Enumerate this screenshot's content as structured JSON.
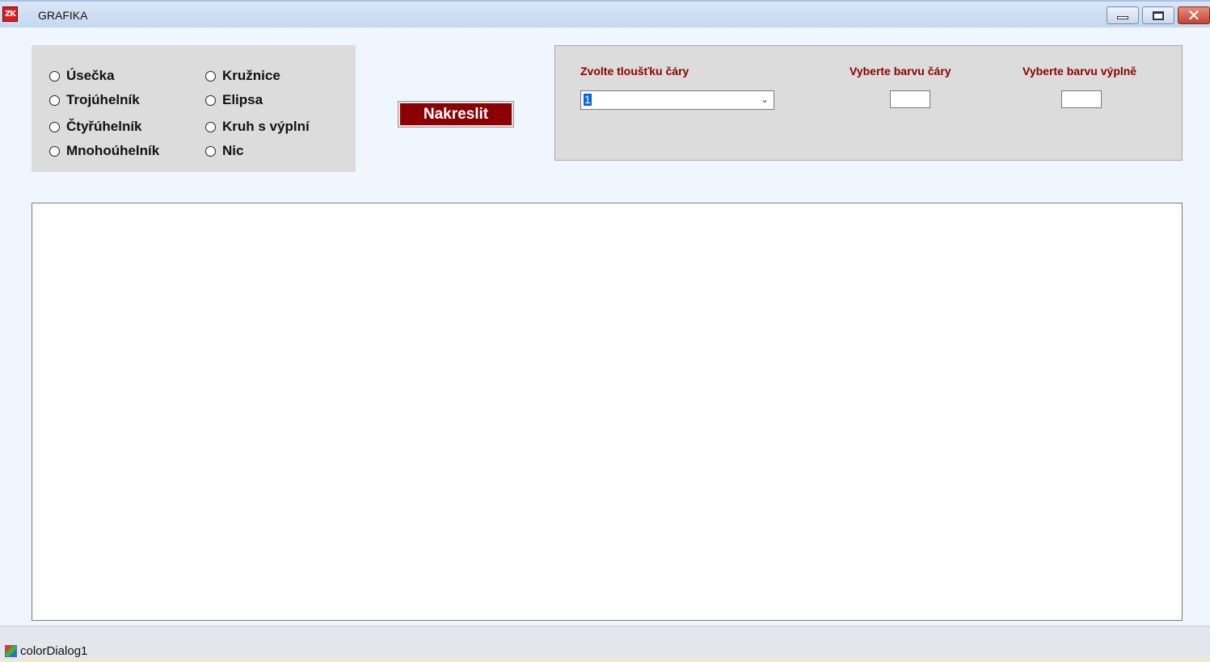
{
  "window": {
    "title": "GRAFIKA",
    "app_icon_text": "ZK",
    "controls": {
      "minimize": "minimize",
      "maximize": "maximize",
      "close": "✕"
    }
  },
  "shapes": {
    "options": [
      {
        "label": "Úsečka"
      },
      {
        "label": "Trojúhelník"
      },
      {
        "label": "Čtyřúhelník"
      },
      {
        "label": "Mnohoúhelník"
      },
      {
        "label": "Kružnice"
      },
      {
        "label": "Elipsa"
      },
      {
        "label": "Kruh s výplní"
      },
      {
        "label": "Nic"
      }
    ]
  },
  "draw_button": {
    "label": "Nakreslit"
  },
  "settings": {
    "line_width_label": "Zvolte tloušťku čáry",
    "line_width_value": "1",
    "line_color_label": "Vyberte barvu čáry",
    "fill_color_label": "Vyberte barvu výplně",
    "line_color": "#ffffff",
    "fill_color": "#ffffff"
  },
  "tray": {
    "component_label": "colorDialog1"
  },
  "colors": {
    "accent": "#8b0000",
    "panel": "#dcdcdc",
    "background": "#f0f6fd"
  }
}
